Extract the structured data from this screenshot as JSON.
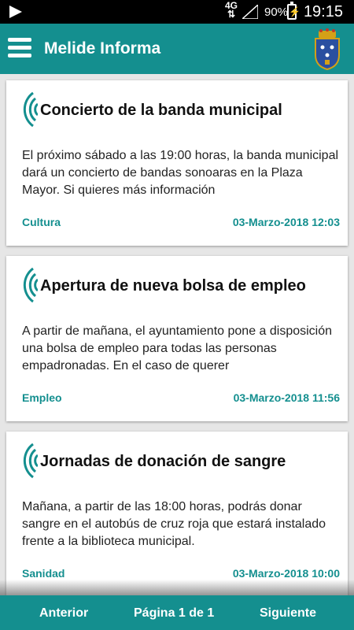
{
  "status_bar": {
    "network": "4G",
    "battery": "90%",
    "time": "19:15",
    "icons": [
      "play-icon",
      "signal-icon",
      "battery-charging-icon"
    ]
  },
  "app_bar": {
    "title": "Melide Informa",
    "icons": [
      "menu-icon",
      "municipal-crest-icon"
    ]
  },
  "news": [
    {
      "title": "Concierto de la banda municipal",
      "body": "El próximo sábado a las 19:00 horas, la banda municipal dará un concierto de bandas sonoaras en la Plaza Mayor. Si quieres más información",
      "category": "Cultura",
      "date": "03-Marzo-2018 12:03"
    },
    {
      "title": "Apertura de nueva bolsa de empleo",
      "body": "A partir de mañana, el ayuntamiento pone a disposición una bolsa de empleo para todas las personas empadronadas. En el caso de querer",
      "category": "Empleo",
      "date": "03-Marzo-2018 11:56"
    },
    {
      "title": "Jornadas de donación de sangre",
      "body": "Mañana, a partir de las 18:00 horas, podrás donar sangre en el autobús de cruz roja que estará instalado frente a la biblioteca municipal.",
      "category": "Sanidad",
      "date": "03-Marzo-2018 10:00"
    }
  ],
  "footer": {
    "prev_label": "Anterior",
    "page_label": "Página 1 de 1",
    "next_label": "Siguiente"
  },
  "colors": {
    "primary": "#148f8f",
    "background": "#e6e6e6",
    "card": "#ffffff"
  }
}
